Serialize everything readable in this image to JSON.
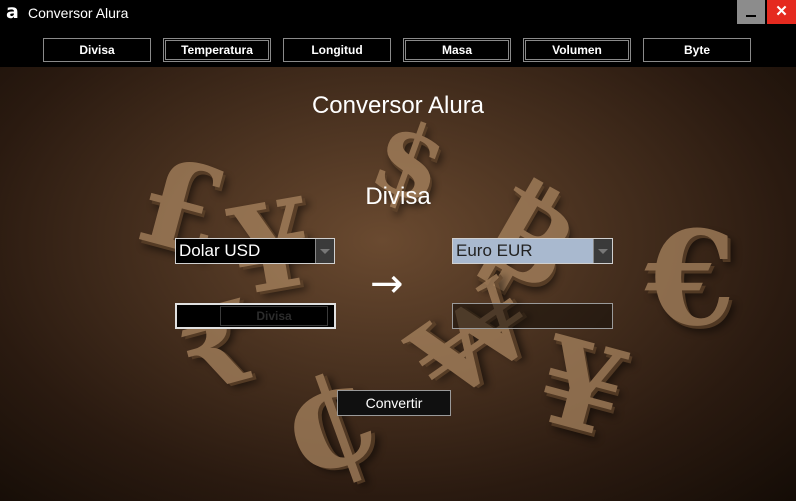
{
  "window": {
    "title": "Conversor Alura",
    "logo_glyph": "a"
  },
  "controls": {
    "close_glyph": "✕"
  },
  "nav": {
    "items": [
      {
        "label": "Divisa"
      },
      {
        "label": "Temperatura",
        "selected": true
      },
      {
        "label": "Longitud"
      },
      {
        "label": "Masa"
      },
      {
        "label": "Volumen"
      },
      {
        "label": "Byte"
      }
    ]
  },
  "main": {
    "app_title": "Conversor Alura",
    "section_title": "Divisa",
    "from_currency": "Dolar USD",
    "to_currency": "Euro EUR",
    "input_placeholder": "Divisa",
    "arrow_glyph": "→",
    "convert_label": "Convertir"
  },
  "colors": {
    "close_button": "#e52a1f",
    "minimize_button": "#8c8c8c",
    "to_select_background": "#a9b9cf"
  },
  "background_glyphs": [
    "£",
    "¥",
    "$",
    "₿",
    "€",
    "₩",
    "¢",
    "₹",
    "¥"
  ]
}
